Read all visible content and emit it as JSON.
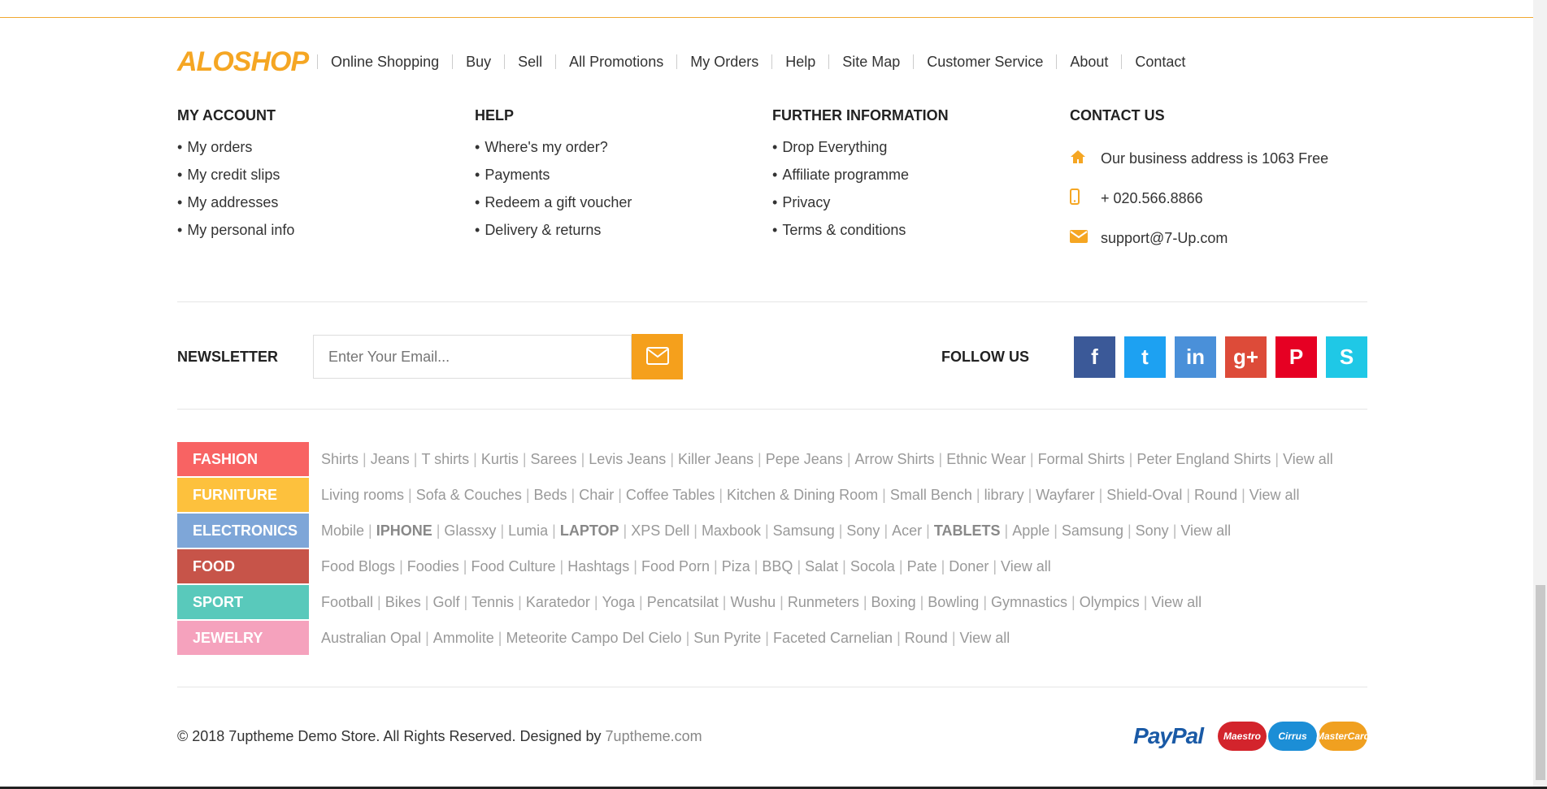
{
  "logo": "ALOSHOP",
  "nav": [
    "Online Shopping",
    "Buy",
    "Sell",
    "All Promotions",
    "My Orders",
    "Help",
    "Site Map",
    "Customer Service",
    "About",
    "Contact"
  ],
  "columns": [
    {
      "title": "MY ACCOUNT",
      "items": [
        "My orders",
        "My credit slips",
        "My addresses",
        "My personal info"
      ]
    },
    {
      "title": "HELP",
      "items": [
        "Where's my order?",
        "Payments",
        "Redeem a gift voucher",
        "Delivery & returns"
      ]
    },
    {
      "title": "FURTHER INFORMATION",
      "items": [
        "Drop Everything",
        "Affiliate programme",
        "Privacy",
        "Terms & conditions"
      ]
    }
  ],
  "contact": {
    "title": "CONTACT US",
    "address": "Our business address is 1063 Free",
    "phone": "+ 020.566.8866",
    "email": "support@7-Up.com",
    "icons": [
      "home-icon",
      "mobile-phone-icon",
      "envelope-icon"
    ]
  },
  "newsletter": {
    "label": "NEWSLETTER",
    "placeholder": "Enter Your Email...",
    "button_icon": "envelope-icon"
  },
  "follow": {
    "label": "FOLLOW US",
    "networks": [
      {
        "name": "facebook",
        "glyph": "f",
        "color": "#3b5998"
      },
      {
        "name": "twitter",
        "glyph": "t",
        "color": "#1da1f2"
      },
      {
        "name": "linkedin",
        "glyph": "in",
        "color": "#4a90d9"
      },
      {
        "name": "google-plus",
        "glyph": "g+",
        "color": "#dd4b39"
      },
      {
        "name": "pinterest",
        "glyph": "P",
        "color": "#e60023"
      },
      {
        "name": "skype",
        "glyph": "S",
        "color": "#1fc8e6"
      }
    ]
  },
  "categories": [
    {
      "name": "FASHION",
      "color": "#f86363",
      "links": [
        "Shirts",
        "Jeans",
        "T shirts",
        "Kurtis",
        "Sarees",
        "Levis Jeans",
        "Killer Jeans",
        "Pepe Jeans",
        "Arrow Shirts",
        "Ethnic Wear",
        "Formal Shirts",
        "Peter England Shirts",
        "View all"
      ],
      "bold": []
    },
    {
      "name": "FURNITURE",
      "color": "#fdc13d",
      "links": [
        "Living rooms",
        "Sofa & Couches",
        "Beds",
        "Chair",
        "Coffee Tables",
        "Kitchen & Dining Room",
        "Small Bench",
        "library",
        "Wayfarer",
        "Shield-Oval",
        "Round",
        "View all"
      ],
      "bold": []
    },
    {
      "name": "ELECTRONICS",
      "color": "#7ea6d8",
      "links": [
        "Mobile",
        "IPHONE",
        "Glassxy",
        "Lumia",
        "LAPTOP",
        "XPS Dell",
        "Maxbook",
        "Samsung",
        "Sony",
        "Acer",
        "TABLETS",
        "Apple",
        "Samsung",
        "Sony",
        "View all"
      ],
      "bold": [
        "IPHONE",
        "LAPTOP",
        "TABLETS"
      ]
    },
    {
      "name": "FOOD",
      "color": "#c75449",
      "links": [
        "Food Blogs",
        "Foodies",
        "Food Culture",
        "Hashtags",
        "Food Porn",
        "Piza",
        "BBQ",
        "Salat",
        "Socola",
        "Pate",
        "Doner",
        "View all"
      ],
      "bold": []
    },
    {
      "name": "SPORT",
      "color": "#59c9bb",
      "links": [
        "Football",
        "Bikes",
        "Golf",
        "Tennis",
        "Karatedor",
        "Yoga",
        "Pencatsilat",
        "Wushu",
        "Runmeters",
        "Boxing",
        "Bowling",
        "Gymnastics",
        "Olympics",
        "View all"
      ],
      "bold": []
    },
    {
      "name": "JEWELRY",
      "color": "#f5a2bd",
      "links": [
        "Australian Opal",
        "Ammolite",
        "Meteorite Campo Del Cielo",
        "Sun Pyrite",
        "Faceted Carnelian",
        "Round",
        "View all"
      ],
      "bold": []
    }
  ],
  "footer": {
    "copyright": "© 2018 7uptheme Demo Store. All Rights Reserved. Designed by ",
    "site": "7uptheme.com",
    "payments": [
      {
        "name": "PayPal",
        "color": "#1a5aa6"
      },
      {
        "name": "Maestro",
        "color": "#d3242c"
      },
      {
        "name": "Cirrus",
        "color": "#1c8ed6"
      },
      {
        "name": "MasterCard",
        "color": "#f0a020"
      }
    ]
  }
}
